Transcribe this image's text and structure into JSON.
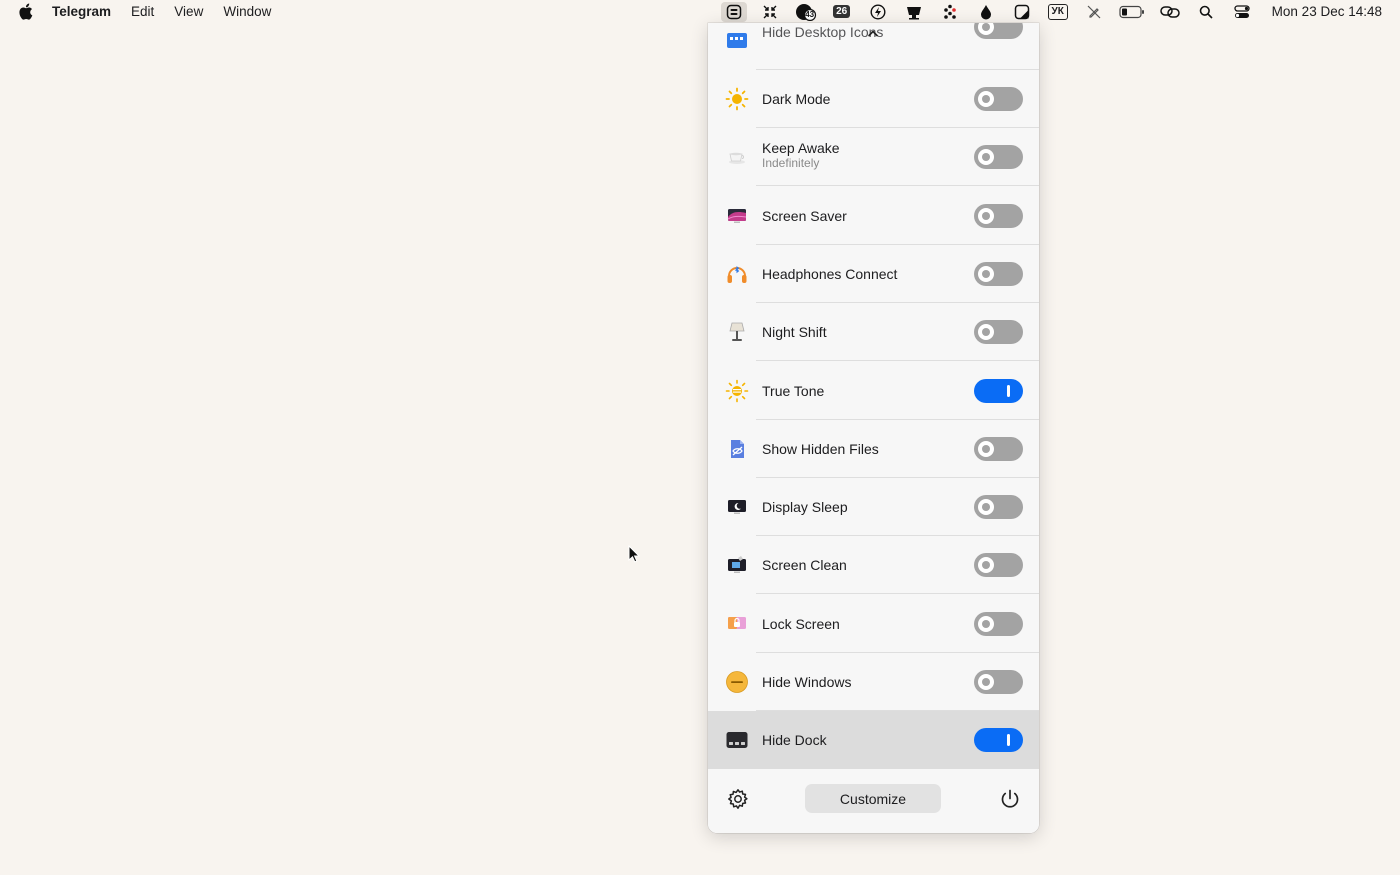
{
  "menubar": {
    "app_name": "Telegram",
    "menus": [
      "Edit",
      "View",
      "Window"
    ],
    "tray": {
      "badge_43": "43",
      "badge_26": "26",
      "keyboard_layout": "УК",
      "clock": "Mon 23 Dec  14:48"
    }
  },
  "panel": {
    "partial_row_title": "Hide Desktop Icons",
    "rows": [
      {
        "title": "Dark Mode",
        "subtitle": "",
        "icon": "sun-icon",
        "on": false
      },
      {
        "title": "Keep Awake",
        "subtitle": "Indefinitely",
        "icon": "coffee-cup-icon",
        "on": false
      },
      {
        "title": "Screen Saver",
        "subtitle": "",
        "icon": "screen-saver-icon",
        "on": false
      },
      {
        "title": "Headphones Connect",
        "subtitle": "",
        "icon": "headphones-icon",
        "on": false
      },
      {
        "title": "Night Shift",
        "subtitle": "",
        "icon": "lamp-icon",
        "on": false
      },
      {
        "title": "True Tone",
        "subtitle": "",
        "icon": "true-tone-icon",
        "on": true
      },
      {
        "title": "Show Hidden Files",
        "subtitle": "",
        "icon": "hidden-files-icon",
        "on": false
      },
      {
        "title": "Display Sleep",
        "subtitle": "",
        "icon": "display-sleep-icon",
        "on": false
      },
      {
        "title": "Screen Clean",
        "subtitle": "",
        "icon": "screen-clean-icon",
        "on": false
      },
      {
        "title": "Lock Screen",
        "subtitle": "",
        "icon": "lock-screen-icon",
        "on": false
      },
      {
        "title": "Hide Windows",
        "subtitle": "",
        "icon": "hide-windows-icon",
        "on": false
      },
      {
        "title": "Hide Dock",
        "subtitle": "",
        "icon": "dock-icon",
        "on": true
      }
    ],
    "footer": {
      "customize_label": "Customize"
    }
  },
  "colors": {
    "desktop_bg": "#f8f4ef",
    "toggle_on": "#0a6cf5",
    "toggle_off": "#a3a3a3"
  }
}
